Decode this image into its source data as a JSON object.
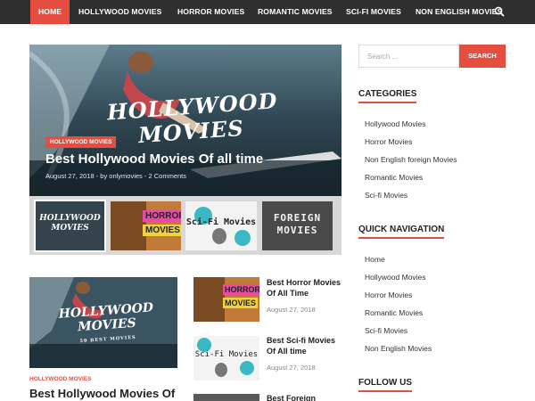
{
  "nav": {
    "items": [
      "HOME",
      "HOLLYWOOD MOVIES",
      "HORROR MOVIES",
      "ROMANTIC MOVIES",
      "SCI-FI MOVIES",
      "NON ENGLISH MOVIES"
    ],
    "search_icon": "search-icon"
  },
  "hero": {
    "logo_line1": "HOLLYWOOD",
    "logo_line2": "MOVIES",
    "category": "HOLLYWOOD MOVIES",
    "title": "Best Hollywood Movies Of all time",
    "meta": "August 27, 2018  -  by onlymovies  -  2 Comments"
  },
  "thumbs": [
    {
      "line1": "HOLLYWOOD",
      "line2": "MOVIES"
    },
    {
      "line1": "HORROR",
      "line2": "MOVIES"
    },
    {
      "line1": "Sci-Fi Movies",
      "line2": ""
    },
    {
      "line1": "FOREIGN",
      "line2": "MOVIES"
    }
  ],
  "main_post": {
    "logo_line1": "HOLLYWOOD",
    "logo_line2": "MOVIES",
    "logo_sub": "50 BEST MOVIES",
    "category": "HOLLYWOOD MOVIES",
    "title": "Best Hollywood Movies Of"
  },
  "side_posts": [
    {
      "title": "Best Horror Movies Of All Time",
      "date": "August 27, 2018",
      "img_line1": "HORROR",
      "img_line2": "MOVIES"
    },
    {
      "title": "Best Sci-fi Movies Of All time",
      "date": "August 27, 2018",
      "img_line1": "Sci-Fi Movies",
      "img_line2": ""
    },
    {
      "title": "Best Foreign",
      "date": "",
      "img_line1": "",
      "img_line2": ""
    }
  ],
  "sidebar": {
    "search_placeholder": "Search ...",
    "search_button": "SEARCH",
    "categories_title": "CATEGORIES",
    "categories": [
      "Hollywood Movies",
      "Horror Movies",
      "Non English foreign Movies",
      "Romantic Movies",
      "Sci-fi Movies"
    ],
    "quicknav_title": "QUICK NAVIGATION",
    "quicknav": [
      "Home",
      "Hollywood Movies",
      "Horror Movies",
      "Romantic Movies",
      "Sci-fi Movies",
      "Non English Movies"
    ],
    "follow_title": "FOLLOW US"
  },
  "colors": {
    "accent": "#e54e3f",
    "nav_bg": "#2f2f2f"
  }
}
